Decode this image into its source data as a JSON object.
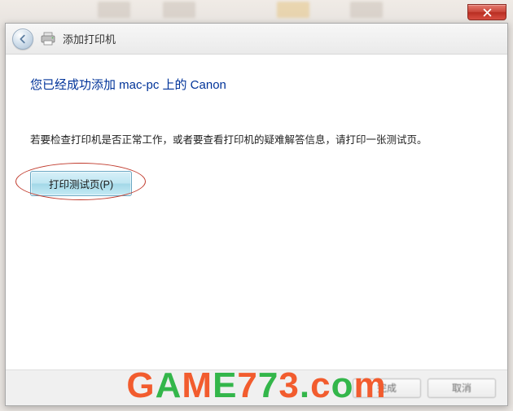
{
  "titlebar": {
    "close_tooltip": "关闭"
  },
  "header": {
    "back_tooltip": "返回",
    "title": "添加打印机"
  },
  "content": {
    "success_heading": "您已经成功添加 mac-pc 上的 Canon",
    "instruction": "若要检查打印机是否正常工作，或者要查看打印机的疑难解答信息，请打印一张测试页。",
    "testprint_label": "打印测试页(P)"
  },
  "footer": {
    "finish_label": "完成",
    "cancel_label": "取消"
  },
  "watermark": {
    "text": "GAME773.com"
  }
}
